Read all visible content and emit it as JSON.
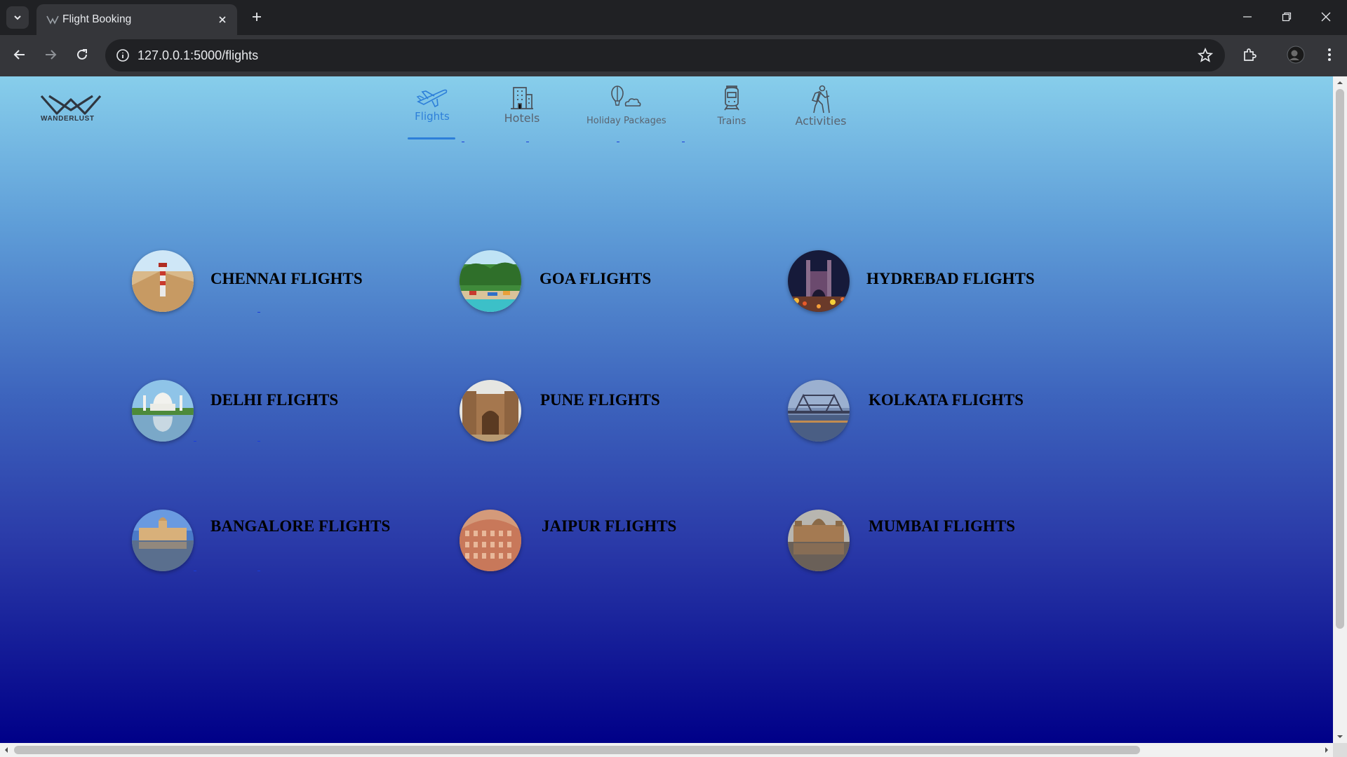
{
  "browser": {
    "tab_title": "Flight Booking",
    "url": "127.0.0.1:5000/flights"
  },
  "site": {
    "logo_text": "WANDERLUST"
  },
  "nav": {
    "flights": "Flights",
    "hotels": "Hotels",
    "holiday_packages": "Holiday Packages",
    "trains": "Trains",
    "activities": "Activities"
  },
  "destinations": [
    {
      "label": "CHENNAI FLIGHTS",
      "scene": "beach-lighthouse"
    },
    {
      "label": "GOA FLIGHTS",
      "scene": "palm-beach"
    },
    {
      "label": "HYDREBAD FLIGHTS",
      "scene": "charminar-night"
    },
    {
      "label": "DELHI FLIGHTS",
      "scene": "taj-mahal"
    },
    {
      "label": "PUNE FLIGHTS",
      "scene": "fort-gate"
    },
    {
      "label": "KOLKATA FLIGHTS",
      "scene": "howrah-bridge"
    },
    {
      "label": "BANGALORE FLIGHTS",
      "scene": "palace-lake"
    },
    {
      "label": "JAIPUR FLIGHTS",
      "scene": "hawa-mahal"
    },
    {
      "label": "MUMBAI FLIGHTS",
      "scene": "taj-hotel"
    }
  ],
  "colors": {
    "accent": "#2d7fd9",
    "gradient_top": "#87ceeb",
    "gradient_bottom": "#000088"
  }
}
